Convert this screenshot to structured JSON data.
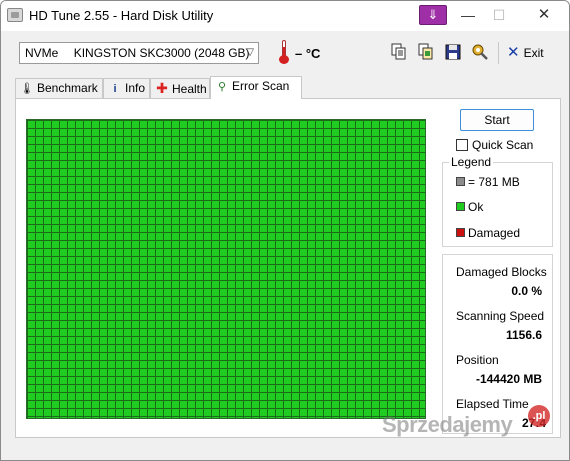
{
  "window": {
    "title": "HD Tune 2.55 - Hard Disk Utility",
    "controls": {
      "minimize": "—",
      "maximize": "☐",
      "close": "✕"
    }
  },
  "toolbar": {
    "drive_bus": "NVMe",
    "drive_name": "KINGSTON SKC3000 (2048 GB)",
    "temperature": "– °C",
    "exit_label": "Exit",
    "icons": [
      "copy-text-icon",
      "copy-screenshot-icon",
      "save-icon",
      "options-icon",
      "exit-icon"
    ]
  },
  "tabs": [
    {
      "label": "Benchmark",
      "icon": "benchmark-icon",
      "active": false
    },
    {
      "label": "Info",
      "icon": "info-icon",
      "active": false
    },
    {
      "label": "Health",
      "icon": "health-cross-icon",
      "active": false
    },
    {
      "label": "Error Scan",
      "icon": "magnifier-icon",
      "active": true
    }
  ],
  "error_scan": {
    "start_label": "Start",
    "quick_scan_label": "Quick Scan",
    "quick_scan_checked": false,
    "legend": {
      "title": "Legend",
      "items": [
        {
          "label": "= 781 MB",
          "color": "#8c8c8c"
        },
        {
          "label": "Ok",
          "color": "#21cc21"
        },
        {
          "label": "Damaged",
          "color": "#cc1111"
        }
      ]
    },
    "stats": [
      {
        "label": "Damaged Blocks",
        "value": "0.0 %"
      },
      {
        "label": "Scanning Speed",
        "value": "1156.6"
      },
      {
        "label": "Position",
        "value": "-144420 MB"
      },
      {
        "label": "Elapsed Time",
        "value": "27:4"
      }
    ],
    "grid_color": "#21cc21"
  },
  "watermark": {
    "text": "Sprzedajemy",
    "badge": ".pl"
  }
}
